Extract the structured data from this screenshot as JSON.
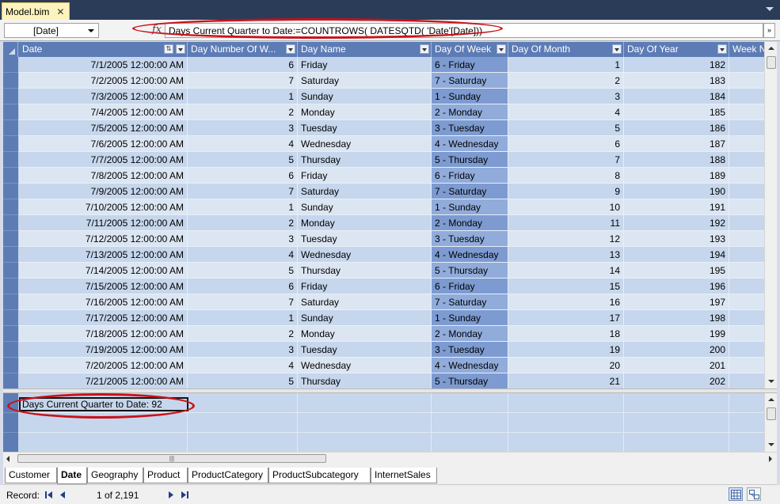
{
  "document_tab": {
    "title": "Model.bim",
    "close": "✕"
  },
  "formula_bar": {
    "column_selector": "[Date]",
    "fx": "fx",
    "formula": "Days Current Quarter to Date:=COUNTROWS( DATESQTD( 'Date'[Date]))",
    "expand": "»"
  },
  "columns": [
    "Date",
    "Day Number Of W...",
    "Day Name",
    "Day Of Week",
    "Day Of Month",
    "Day Of Year",
    "Week N"
  ],
  "rows": [
    [
      "7/1/2005 12:00:00 AM",
      "6",
      "Friday",
      "6 - Friday",
      "1",
      "182"
    ],
    [
      "7/2/2005 12:00:00 AM",
      "7",
      "Saturday",
      "7 - Saturday",
      "2",
      "183"
    ],
    [
      "7/3/2005 12:00:00 AM",
      "1",
      "Sunday",
      "1 - Sunday",
      "3",
      "184"
    ],
    [
      "7/4/2005 12:00:00 AM",
      "2",
      "Monday",
      "2 - Monday",
      "4",
      "185"
    ],
    [
      "7/5/2005 12:00:00 AM",
      "3",
      "Tuesday",
      "3 - Tuesday",
      "5",
      "186"
    ],
    [
      "7/6/2005 12:00:00 AM",
      "4",
      "Wednesday",
      "4 - Wednesday",
      "6",
      "187"
    ],
    [
      "7/7/2005 12:00:00 AM",
      "5",
      "Thursday",
      "5 - Thursday",
      "7",
      "188"
    ],
    [
      "7/8/2005 12:00:00 AM",
      "6",
      "Friday",
      "6 - Friday",
      "8",
      "189"
    ],
    [
      "7/9/2005 12:00:00 AM",
      "7",
      "Saturday",
      "7 - Saturday",
      "9",
      "190"
    ],
    [
      "7/10/2005 12:00:00 AM",
      "1",
      "Sunday",
      "1 - Sunday",
      "10",
      "191"
    ],
    [
      "7/11/2005 12:00:00 AM",
      "2",
      "Monday",
      "2 - Monday",
      "11",
      "192"
    ],
    [
      "7/12/2005 12:00:00 AM",
      "3",
      "Tuesday",
      "3 - Tuesday",
      "12",
      "193"
    ],
    [
      "7/13/2005 12:00:00 AM",
      "4",
      "Wednesday",
      "4 - Wednesday",
      "13",
      "194"
    ],
    [
      "7/14/2005 12:00:00 AM",
      "5",
      "Thursday",
      "5 - Thursday",
      "14",
      "195"
    ],
    [
      "7/15/2005 12:00:00 AM",
      "6",
      "Friday",
      "6 - Friday",
      "15",
      "196"
    ],
    [
      "7/16/2005 12:00:00 AM",
      "7",
      "Saturday",
      "7 - Saturday",
      "16",
      "197"
    ],
    [
      "7/17/2005 12:00:00 AM",
      "1",
      "Sunday",
      "1 - Sunday",
      "17",
      "198"
    ],
    [
      "7/18/2005 12:00:00 AM",
      "2",
      "Monday",
      "2 - Monday",
      "18",
      "199"
    ],
    [
      "7/19/2005 12:00:00 AM",
      "3",
      "Tuesday",
      "3 - Tuesday",
      "19",
      "200"
    ],
    [
      "7/20/2005 12:00:00 AM",
      "4",
      "Wednesday",
      "4 - Wednesday",
      "20",
      "201"
    ],
    [
      "7/21/2005 12:00:00 AM",
      "5",
      "Thursday",
      "5 - Thursday",
      "21",
      "202"
    ]
  ],
  "measure": {
    "text": "Days Current Quarter to Date: 92"
  },
  "sheet_tabs": [
    {
      "label": "Customer",
      "active": false
    },
    {
      "label": "Date",
      "active": true
    },
    {
      "label": "Geography",
      "active": false
    },
    {
      "label": "Product",
      "active": false
    },
    {
      "label": "ProductCategory",
      "active": false
    },
    {
      "label": "ProductSubcategory",
      "active": false
    },
    {
      "label": "InternetSales",
      "active": false
    }
  ],
  "status": {
    "record_label": "Record:",
    "record_count": "1 of 2,191"
  },
  "colors": {
    "header_bg": "#5d7cb5",
    "annotation_red": "#c8121b",
    "tab_active": "#fdf3be"
  }
}
